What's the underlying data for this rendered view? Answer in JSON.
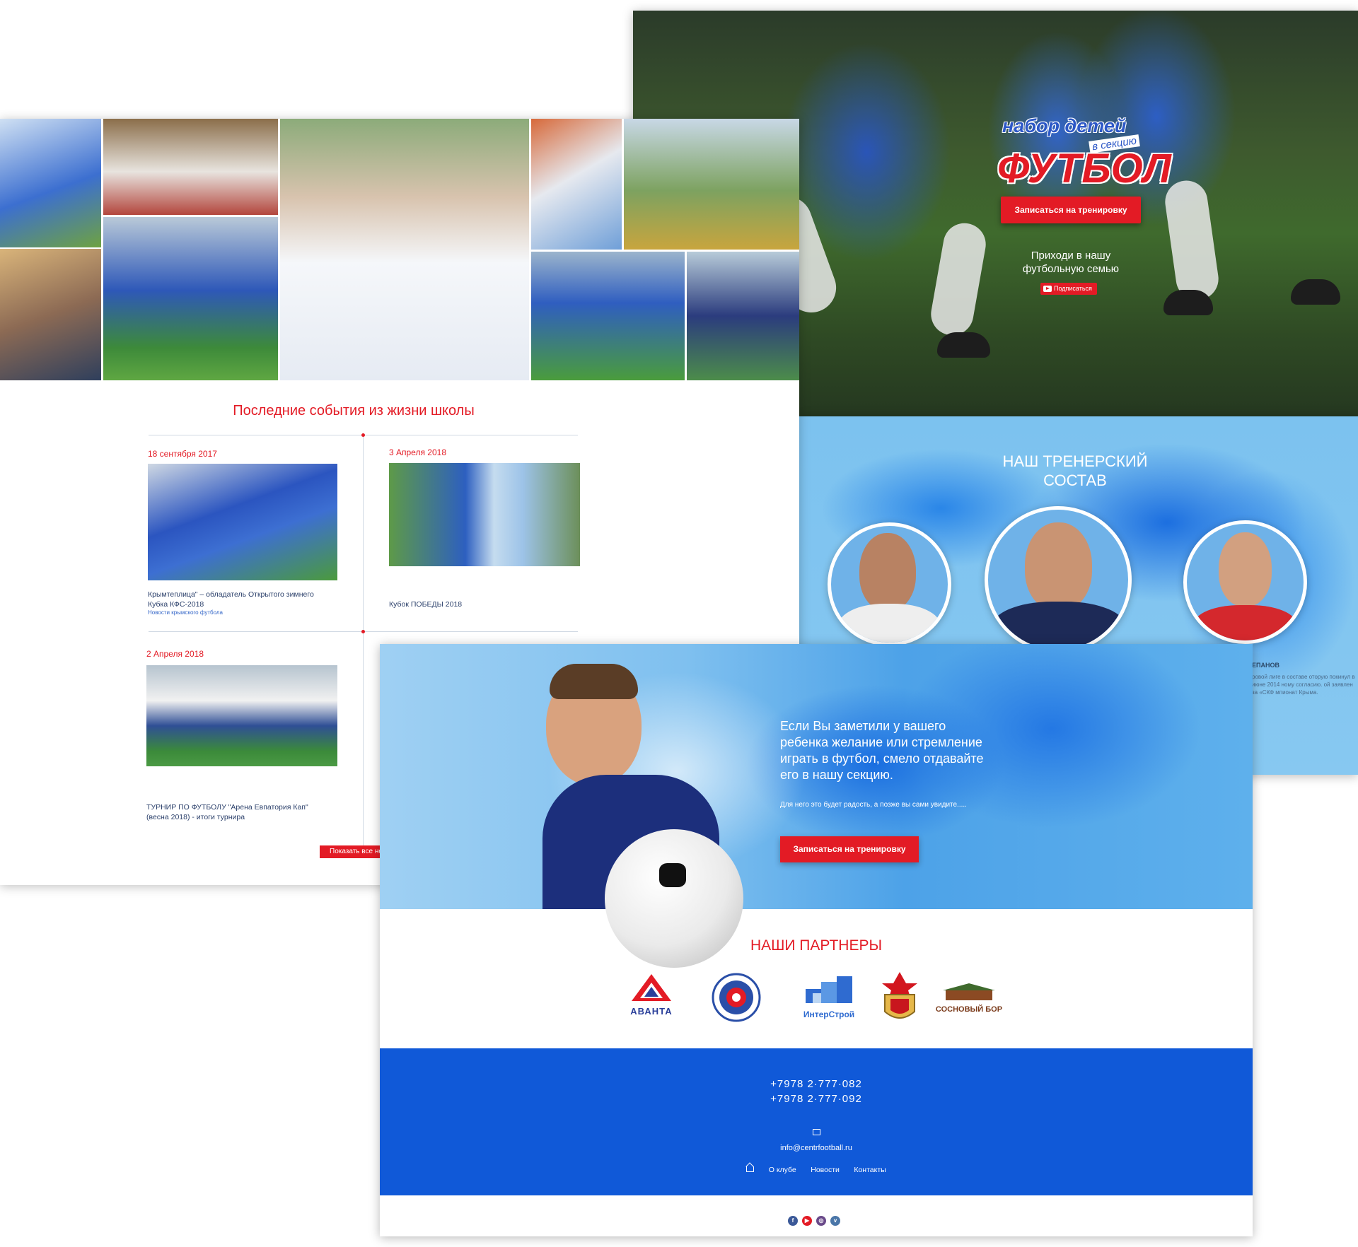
{
  "hero": {
    "logo_line1": "набор детей",
    "logo_sub": "в секцию",
    "logo_line2": "ФУТБОЛ",
    "cta": "Записаться на тренировку",
    "tagline": "Приходи в нашу футбольную семью",
    "subscribe": "Подписаться"
  },
  "coaches": {
    "title": "НАШ ТРЕНЕРСКИЙ СОСТАВ",
    "partial_name": "ЕПАНОВ",
    "partial_text": "ровой лиге в составе оторую покинул в июне 2014 ному согласию. ой заявлен за «СКФ мпионат Крыма."
  },
  "news": {
    "section_title": "Последние события из жизни школы",
    "items": [
      {
        "date": "18 сентября 2017",
        "caption": "Крымтеплица\" – обладатель Открытого зимнего Кубка КФС-2018",
        "category": "Новости крымского футбола"
      },
      {
        "date": "3 Апреля 2018",
        "caption": "Кубок ПОБЕДЫ 2018",
        "category": ""
      },
      {
        "date": "2 Апреля 2018",
        "caption": "ТУРНИР ПО ФУТБОЛУ \"Арена Евпатория Кап\" (весна 2018) - итоги турнира",
        "category": ""
      }
    ],
    "more_button": "Показать все но"
  },
  "banner": {
    "text": "Если Вы заметили  у вашего ребенка желание или стремление играть в футбол, смело отдавайте его в нашу секцию.",
    "small": "Для него это будет радость, а позже вы сами увидите.....",
    "cta": "Записаться на тренировку"
  },
  "partners": {
    "title": "НАШИ ПАРТНЕРЫ",
    "logos": [
      "АВАНТА",
      "ИнтерСтрой",
      "СОСНОВЫЙ БОР"
    ]
  },
  "footer": {
    "phone1": "+7978  2·777·082",
    "phone2": "+7978  2·777·092",
    "email": "info@centrfootball.ru",
    "nav": [
      "О клубе",
      "Новости",
      "Контакты"
    ]
  },
  "colors": {
    "accent": "#e31b25",
    "footer_blue": "#1059d8",
    "sky": "#7cc2ef"
  },
  "icons": [
    "youtube-icon",
    "mail-icon",
    "home-icon",
    "facebook-icon",
    "youtube-icon",
    "instagram-icon",
    "vk-icon"
  ]
}
